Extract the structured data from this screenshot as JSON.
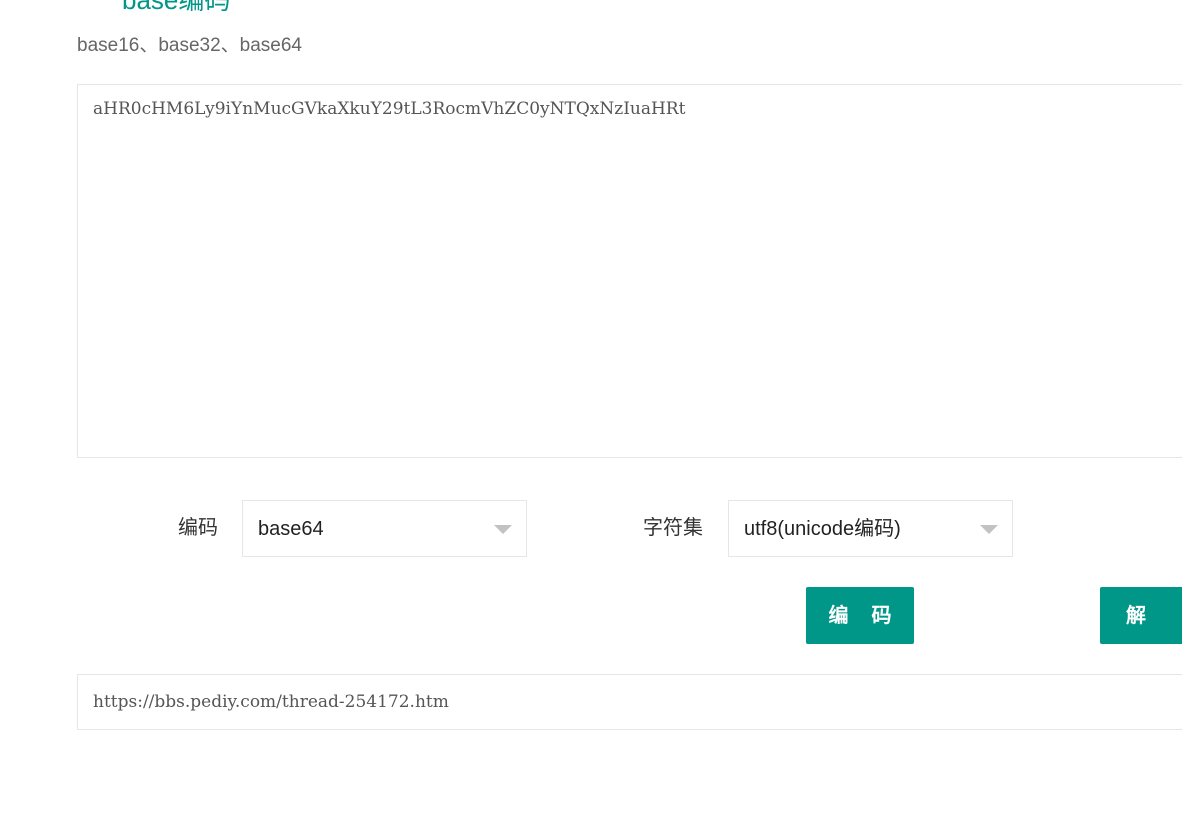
{
  "header": {
    "title": "base编码",
    "subtitle": "base16、base32、base64"
  },
  "input": {
    "value": "aHR0cHM6Ly9iYnMucGVkaXkuY29tL3RocmVhZC0yNTQxNzIuaHRt"
  },
  "options": {
    "encoding_label": "编码",
    "encoding_value": "base64",
    "charset_label": "字符集",
    "charset_value": "utf8(unicode编码)"
  },
  "actions": {
    "encode_label": "编 码",
    "decode_label": "解 码"
  },
  "output": {
    "value": "https://bbs.pediy.com/thread-254172.htm"
  },
  "colors": {
    "accent": "#009688",
    "border": "#e6e6e6",
    "arrow": "#c2c2c2"
  },
  "icons": {
    "dropdown": "caret-down-icon"
  }
}
